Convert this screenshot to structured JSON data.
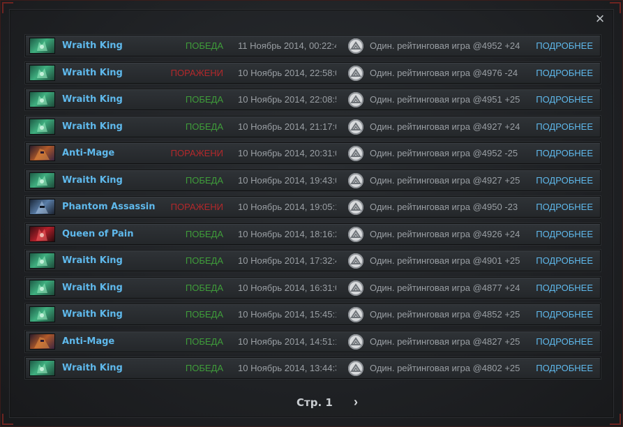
{
  "window": {
    "close_label": "×",
    "colors": {
      "accent": "#5fb9ec",
      "win": "#3f9d3a",
      "loss": "#b3282b",
      "text_muted": "#9a9fa4"
    }
  },
  "matches": [
    {
      "hero": "Wraith King",
      "portrait": "wraith",
      "result": "ПОБЕДА",
      "outcome": "win",
      "date": "11 Ноябрь 2014, 00:22:4",
      "mode": "Один. рейтинговая игра @4952 +24",
      "details": "ПОДРОБНЕЕ"
    },
    {
      "hero": "Wraith King",
      "portrait": "wraith",
      "result": "ПОРАЖЕНИ",
      "outcome": "loss",
      "date": "10 Ноябрь 2014, 22:58:0",
      "mode": "Один. рейтинговая игра @4976 -24",
      "details": "ПОДРОБНЕЕ"
    },
    {
      "hero": "Wraith King",
      "portrait": "wraith",
      "result": "ПОБЕДА",
      "outcome": "win",
      "date": "10 Ноябрь 2014, 22:08:5",
      "mode": "Один. рейтинговая игра @4951 +25",
      "details": "ПОДРОБНЕЕ"
    },
    {
      "hero": "Wraith King",
      "portrait": "wraith",
      "result": "ПОБЕДА",
      "outcome": "win",
      "date": "10 Ноябрь 2014, 21:17:0",
      "mode": "Один. рейтинговая игра @4927 +24",
      "details": "ПОДРОБНЕЕ"
    },
    {
      "hero": "Anti-Mage",
      "portrait": "antimage",
      "result": "ПОРАЖЕНИ",
      "outcome": "loss",
      "date": "10 Ноябрь 2014, 20:31:0",
      "mode": "Один. рейтинговая игра @4952 -25",
      "details": "ПОДРОБНЕЕ"
    },
    {
      "hero": "Wraith King",
      "portrait": "wraith",
      "result": "ПОБЕДА",
      "outcome": "win",
      "date": "10 Ноябрь 2014, 19:43:0",
      "mode": "Один. рейтинговая игра @4927 +25",
      "details": "ПОДРОБНЕЕ"
    },
    {
      "hero": "Phantom Assassin",
      "portrait": "pa",
      "result": "ПОРАЖЕНИ",
      "outcome": "loss",
      "date": "10 Ноябрь 2014, 19:05:1",
      "mode": "Один. рейтинговая игра @4950 -23",
      "details": "ПОДРОБНЕЕ"
    },
    {
      "hero": "Queen of Pain",
      "portrait": "qop",
      "result": "ПОБЕДА",
      "outcome": "win",
      "date": "10 Ноябрь 2014, 18:16:2",
      "mode": "Один. рейтинговая игра @4926 +24",
      "details": "ПОДРОБНЕЕ"
    },
    {
      "hero": "Wraith King",
      "portrait": "wraith",
      "result": "ПОБЕДА",
      "outcome": "win",
      "date": "10 Ноябрь 2014, 17:32:4",
      "mode": "Один. рейтинговая игра @4901 +25",
      "details": "ПОДРОБНЕЕ"
    },
    {
      "hero": "Wraith King",
      "portrait": "wraith",
      "result": "ПОБЕДА",
      "outcome": "win",
      "date": "10 Ноябрь 2014, 16:31:0",
      "mode": "Один. рейтинговая игра @4877 +24",
      "details": "ПОДРОБНЕЕ"
    },
    {
      "hero": "Wraith King",
      "portrait": "wraith",
      "result": "ПОБЕДА",
      "outcome": "win",
      "date": "10 Ноябрь 2014, 15:45:1",
      "mode": "Один. рейтинговая игра @4852 +25",
      "details": "ПОДРОБНЕЕ"
    },
    {
      "hero": "Anti-Mage",
      "portrait": "antimage",
      "result": "ПОБЕДА",
      "outcome": "win",
      "date": "10 Ноябрь 2014, 14:51:1",
      "mode": "Один. рейтинговая игра @4827 +25",
      "details": "ПОДРОБНЕЕ"
    },
    {
      "hero": "Wraith King",
      "portrait": "wraith",
      "result": "ПОБЕДА",
      "outcome": "win",
      "date": "10 Ноябрь 2014, 13:44:3",
      "mode": "Один. рейтинговая игра @4802 +25",
      "details": "ПОДРОБНЕЕ"
    }
  ],
  "pagination": {
    "page_label": "Стр. 1",
    "next_label": "›"
  },
  "icons": {
    "close": "close-icon",
    "next": "chevron-right-icon",
    "mode": "ranked-mode-icon",
    "portrait": "hero-portrait-icon"
  }
}
